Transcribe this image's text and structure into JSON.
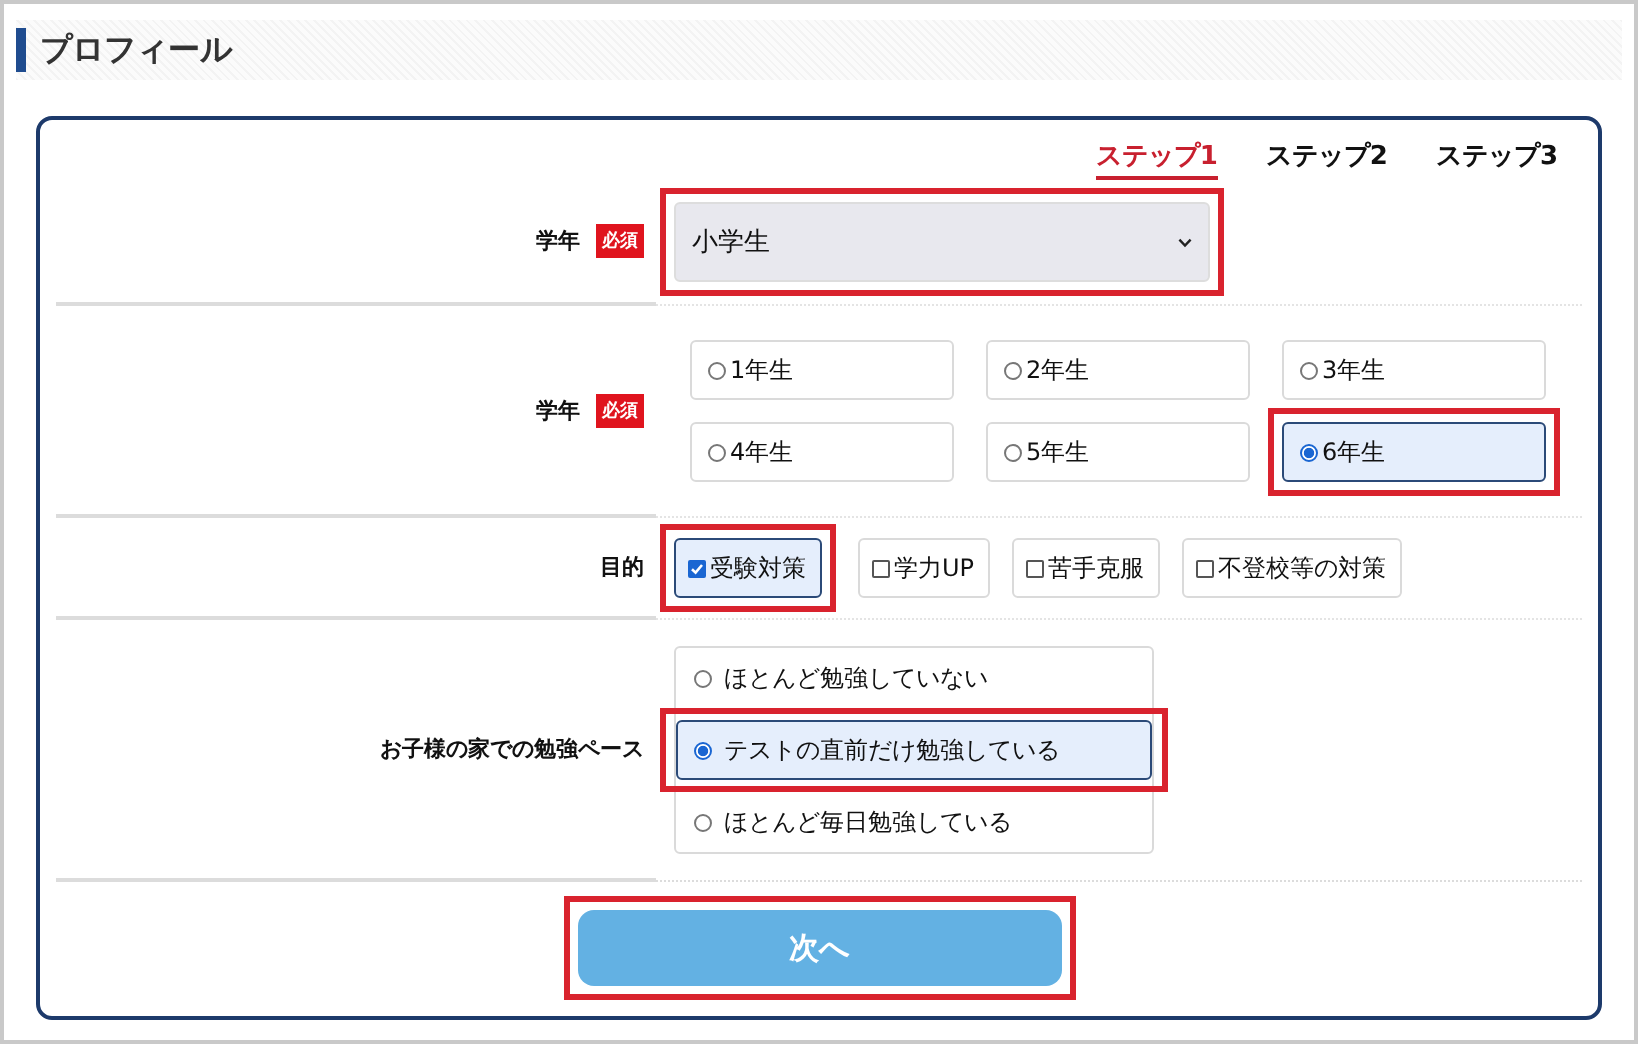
{
  "heading": "プロフィール",
  "steps": [
    {
      "label": "ステップ1",
      "selected": true
    },
    {
      "label": "ステップ2",
      "selected": false
    },
    {
      "label": "ステップ3",
      "selected": false
    }
  ],
  "fields": [
    {
      "kind": "select",
      "label": "学年",
      "required_badge": "必須",
      "value": "小学生",
      "highlighted": true
    },
    {
      "kind": "radio_grid",
      "label": "学年",
      "required_badge": "必須",
      "options": [
        {
          "label": "1年生",
          "selected": false,
          "highlighted": false
        },
        {
          "label": "2年生",
          "selected": false,
          "highlighted": false
        },
        {
          "label": "3年生",
          "selected": false,
          "highlighted": false
        },
        {
          "label": "4年生",
          "selected": false,
          "highlighted": false
        },
        {
          "label": "5年生",
          "selected": false,
          "highlighted": false
        },
        {
          "label": "6年生",
          "selected": true,
          "highlighted": true
        }
      ]
    },
    {
      "kind": "checkbox_row",
      "label": "目的",
      "options": [
        {
          "label": "受験対策",
          "checked": true,
          "highlighted": true
        },
        {
          "label": "学力UP",
          "checked": false,
          "highlighted": false
        },
        {
          "label": "苦手克服",
          "checked": false,
          "highlighted": false
        },
        {
          "label": "不登校等の対策",
          "checked": false,
          "highlighted": false
        }
      ]
    },
    {
      "kind": "radio_list",
      "label": "お子様の家での勉強ペース",
      "options": [
        {
          "label": "ほとんど勉強していない",
          "selected": false,
          "highlighted": false
        },
        {
          "label": "テストの直前だけ勉強している",
          "selected": true,
          "highlighted": true
        },
        {
          "label": "ほとんど毎日勉強している",
          "selected": false,
          "highlighted": false
        }
      ]
    }
  ],
  "next_button": {
    "label": "次へ",
    "highlighted": true
  }
}
